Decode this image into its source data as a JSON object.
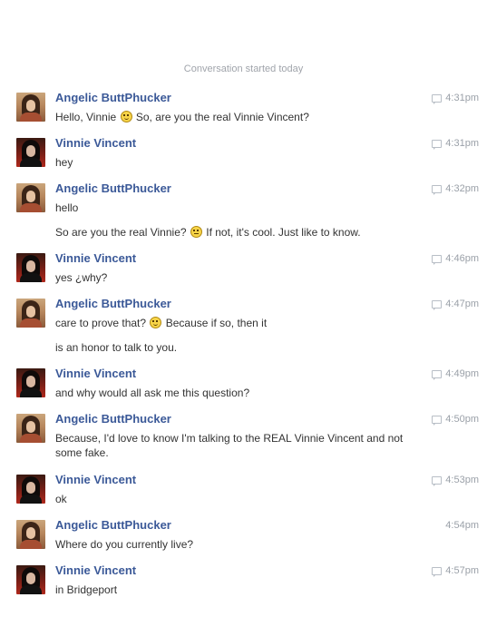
{
  "header": {
    "started_label": "Conversation started today"
  },
  "messages": [
    {
      "sender": "Angelic ButtPhucker",
      "time": "4:31pm",
      "lines": [
        "Hello, Vinnie",
        "So, are you the real Vinnie Vincent?"
      ]
    },
    {
      "sender": "Vinnie Vincent",
      "time": "4:31pm",
      "lines": [
        "hey"
      ]
    },
    {
      "sender": "Angelic ButtPhucker",
      "time": "4:32pm",
      "lines": [
        "hello",
        "So are you the real Vinnie?",
        "If not, it's cool. Just like to know."
      ]
    },
    {
      "sender": "Vinnie Vincent",
      "time": "4:46pm",
      "lines": [
        "yes ¿why?"
      ]
    },
    {
      "sender": "Angelic ButtPhucker",
      "time": "4:47pm",
      "lines": [
        "care to prove that?",
        "Because if so, then it",
        "is an honor to talk to you."
      ]
    },
    {
      "sender": "Vinnie Vincent",
      "time": "4:49pm",
      "lines": [
        "and why would all ask me this question?"
      ]
    },
    {
      "sender": "Angelic ButtPhucker",
      "time": "4:50pm",
      "lines": [
        "Because, I'd love to know I'm talking to the REAL Vinnie Vincent and not",
        "some fake."
      ]
    },
    {
      "sender": "Vinnie Vincent",
      "time": "4:53pm",
      "lines": [
        "ok"
      ]
    },
    {
      "sender": "Angelic ButtPhucker",
      "time": "4:54pm",
      "lines": [
        "Where do you currently live?"
      ]
    },
    {
      "sender": "Vinnie Vincent",
      "time": "4:57pm",
      "lines": [
        "in Bridgeport"
      ]
    }
  ],
  "icons": {
    "timestamp": "chat-bubble-icon",
    "emoticon_smile": "smiley-icon",
    "emoticon_unsure": "unsure-smiley-icon"
  }
}
